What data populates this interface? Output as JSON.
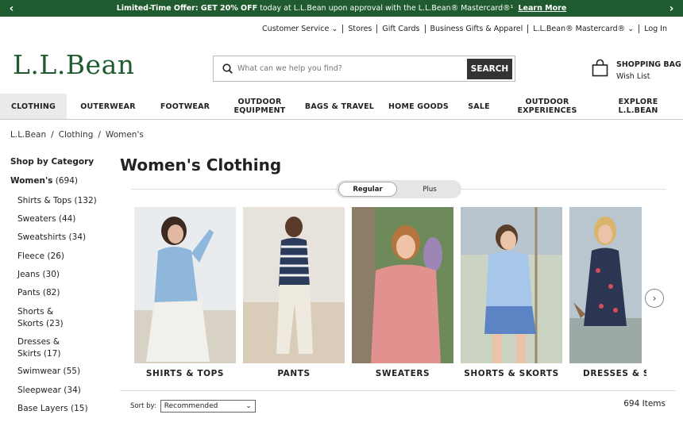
{
  "promo": {
    "bold1": "Limited-Time Offer: GET 20% OFF",
    "text": " today at L.L.Bean upon approval with the L.L.Bean® Mastercard®¹ ",
    "link": "Learn More"
  },
  "utility": {
    "customer_service": "Customer Service",
    "stores": "Stores",
    "gift_cards": "Gift Cards",
    "business": "Business Gifts & Apparel",
    "mastercard": "L.L.Bean® Mastercard®",
    "login": "Log In"
  },
  "logo": "L.L.Bean",
  "search": {
    "placeholder": "What can we help you find?",
    "button": "SEARCH"
  },
  "bag": {
    "title": "SHOPPING BAG",
    "wishlist": "Wish List"
  },
  "nav": [
    "CLOTHING",
    "OUTERWEAR",
    "FOOTWEAR",
    "OUTDOOR EQUIPMENT",
    "BAGS & TRAVEL",
    "HOME GOODS",
    "SALE",
    "OUTDOOR EXPERIENCES",
    "EXPLORE L.L.BEAN"
  ],
  "breadcrumb": [
    "L.L.Bean",
    "Clothing",
    "Women's"
  ],
  "sidebar": {
    "heading": "Shop by Category",
    "womens": "Women's",
    "womens_count": "(694)",
    "items": [
      "Shirts & Tops (132)",
      "Sweaters (44)",
      "Sweatshirts (34)",
      "Fleece (26)",
      "Jeans (30)",
      "Pants (82)",
      "Shorts & Skorts (23)",
      "Dresses & Skirts (17)",
      "Swimwear (55)",
      "Sleepwear (34)",
      "Base Layers (15)"
    ]
  },
  "page_title": "Women's Clothing",
  "fit_toggle": {
    "regular": "Regular",
    "plus": "Plus"
  },
  "categories": [
    "SHIRTS & TOPS",
    "PANTS",
    "SWEATERS",
    "SHORTS & SKORTS",
    "DRESSES & SK"
  ],
  "sort": {
    "label": "Sort by:",
    "value": "Recommended"
  },
  "item_count": "694 Items",
  "colors": {
    "brand_green": "#1f5b2e",
    "search_button": "#333333"
  }
}
